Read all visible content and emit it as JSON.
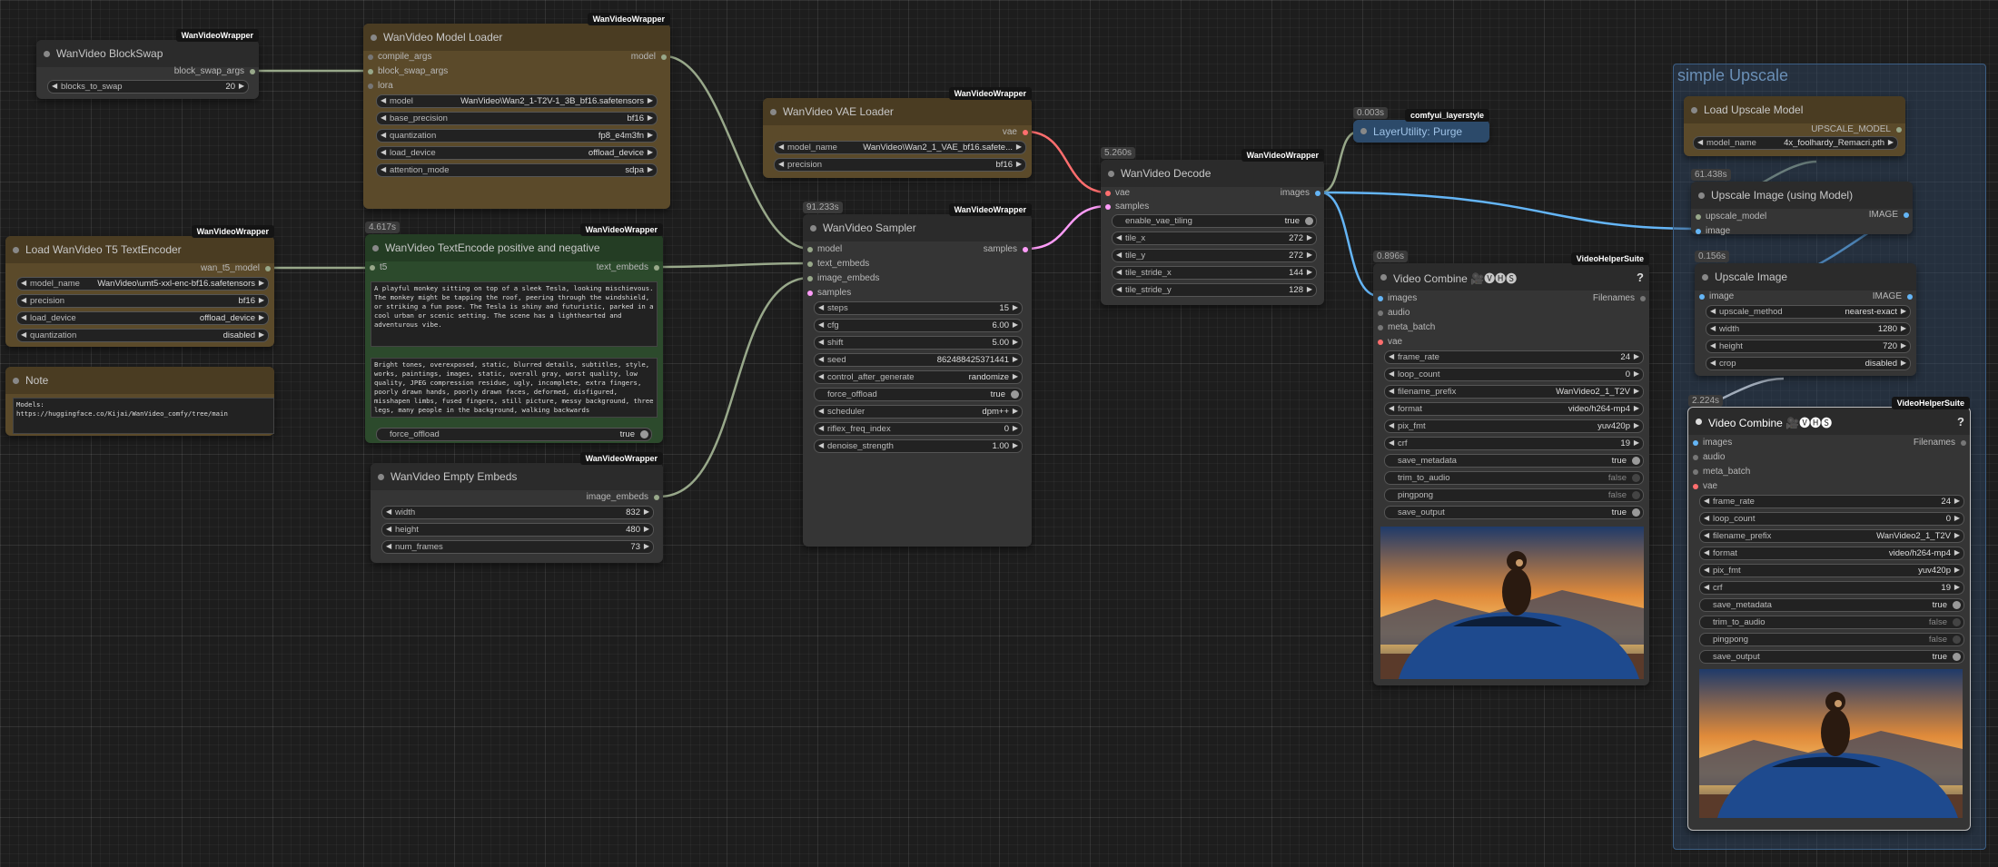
{
  "nodes": {
    "blockswap": {
      "title": "WanVideo BlockSwap",
      "badge": "WanVideoWrapper",
      "out": "block_swap_args",
      "w_blocks": {
        "label": "blocks_to_swap",
        "value": "20"
      }
    },
    "model_loader": {
      "title": "WanVideo Model Loader",
      "badge": "WanVideoWrapper",
      "in_compile": "compile_args",
      "in_block": "block_swap_args",
      "in_lora": "lora",
      "out": "model",
      "widgets": [
        {
          "label": "model",
          "value": "WanVideo\\Wan2_1-T2V-1_3B_bf16.safetensors"
        },
        {
          "label": "base_precision",
          "value": "bf16"
        },
        {
          "label": "quantization",
          "value": "fp8_e4m3fn"
        },
        {
          "label": "load_device",
          "value": "offload_device"
        },
        {
          "label": "attention_mode",
          "value": "sdpa"
        }
      ]
    },
    "t5": {
      "title": "Load WanVideo T5 TextEncoder",
      "badge": "WanVideoWrapper",
      "out": "wan_t5_model",
      "widgets": [
        {
          "label": "model_name",
          "value": "WanVideo\\umt5-xxl-enc-bf16.safetensors"
        },
        {
          "label": "precision",
          "value": "bf16"
        },
        {
          "label": "load_device",
          "value": "offload_device"
        },
        {
          "label": "quantization",
          "value": "disabled"
        }
      ]
    },
    "note": {
      "title": "Note",
      "text": "Models:\nhttps://huggingface.co/Kijai/WanVideo_comfy/tree/main"
    },
    "textencode": {
      "title": "WanVideo TextEncode positive and negative",
      "badge": "WanVideoWrapper",
      "time": "4.617s",
      "in": "t5",
      "out": "text_embeds",
      "positive": "A playful monkey sitting on top of a sleek Tesla, looking mischievous. The monkey might be tapping the roof, peering through the windshield, or striking a fun pose. The Tesla is shiny and futuristic, parked in a cool urban or scenic setting. The scene has a lighthearted and adventurous vibe.",
      "negative": "Bright tones, overexposed, static, blurred details, subtitles, style, works, paintings, images, static, overall gray, worst quality, low quality, JPEG compression residue, ugly, incomplete, extra fingers, poorly drawn hands, poorly drawn faces, deformed, disfigured, misshapen limbs, fused fingers, still picture, messy background, three legs, many people in the background, walking backwards",
      "w_offload": {
        "label": "force_offload",
        "value": "true"
      }
    },
    "empty": {
      "title": "WanVideo Empty Embeds",
      "badge": "WanVideoWrapper",
      "out": "image_embeds",
      "widgets": [
        {
          "label": "width",
          "value": "832"
        },
        {
          "label": "height",
          "value": "480"
        },
        {
          "label": "num_frames",
          "value": "73"
        }
      ]
    },
    "vae_loader": {
      "title": "WanVideo VAE Loader",
      "badge": "WanVideoWrapper",
      "out": "vae",
      "widgets": [
        {
          "label": "model_name",
          "value": "WanVideo\\Wan2_1_VAE_bf16.safete..."
        },
        {
          "label": "precision",
          "value": "bf16"
        }
      ]
    },
    "sampler": {
      "title": "WanVideo Sampler",
      "badge": "WanVideoWrapper",
      "time": "91.233s",
      "inputs": [
        "model",
        "text_embeds",
        "image_embeds",
        "samples"
      ],
      "out": "samples",
      "widgets": [
        {
          "label": "steps",
          "value": "15"
        },
        {
          "label": "cfg",
          "value": "6.00"
        },
        {
          "label": "shift",
          "value": "5.00"
        },
        {
          "label": "seed",
          "value": "862488425371441"
        },
        {
          "label": "control_after_generate",
          "value": "randomize"
        },
        {
          "label": "force_offload",
          "value": "true",
          "toggle": true
        },
        {
          "label": "scheduler",
          "value": "dpm++"
        },
        {
          "label": "riflex_freq_index",
          "value": "0"
        },
        {
          "label": "denoise_strength",
          "value": "1.00"
        }
      ]
    },
    "decode": {
      "title": "WanVideo Decode",
      "badge": "WanVideoWrapper",
      "time": "5.260s",
      "in_vae": "vae",
      "in_samples": "samples",
      "out": "images",
      "widgets": [
        {
          "label": "enable_vae_tiling",
          "value": "true",
          "toggle": true
        },
        {
          "label": "tile_x",
          "value": "272"
        },
        {
          "label": "tile_y",
          "value": "272"
        },
        {
          "label": "tile_stride_x",
          "value": "144"
        },
        {
          "label": "tile_stride_y",
          "value": "128"
        }
      ]
    },
    "purge": {
      "title": "LayerUtility: Purge",
      "badge": "comfyui_layerstyle",
      "time": "0.003s"
    },
    "vc1": {
      "title": "Video Combine 🎥🅥🅗🅢",
      "badge": "VideoHelperSuite",
      "time": "0.896s",
      "help": "?",
      "inputs": [
        "images",
        "audio",
        "meta_batch",
        "vae"
      ],
      "out": "Filenames",
      "widgets": [
        {
          "label": "frame_rate",
          "value": "24"
        },
        {
          "label": "loop_count",
          "value": "0"
        },
        {
          "label": "filename_prefix",
          "value": "WanVideo2_1_T2V"
        },
        {
          "label": "format",
          "value": "video/h264-mp4"
        },
        {
          "label": "pix_fmt",
          "value": "yuv420p"
        },
        {
          "label": "crf",
          "value": "19"
        },
        {
          "label": "save_metadata",
          "value": "true",
          "toggle": true
        },
        {
          "label": "trim_to_audio",
          "value": "false",
          "toggle": true,
          "off": true
        },
        {
          "label": "pingpong",
          "value": "false",
          "toggle": true,
          "off": true
        },
        {
          "label": "save_output",
          "value": "true",
          "toggle": true
        }
      ]
    },
    "group": {
      "title": "simple Upscale"
    },
    "upmodel": {
      "title": "Load Upscale Model",
      "out": "UPSCALE_MODEL",
      "widgets": [
        {
          "label": "model_name",
          "value": "4x_foolhardy_Remacri.pth"
        }
      ]
    },
    "upimgmodel": {
      "title": "Upscale Image (using Model)",
      "time": "61.438s",
      "inputs": [
        "upscale_model",
        "image"
      ],
      "out": "IMAGE"
    },
    "upimg": {
      "title": "Upscale Image",
      "time": "0.156s",
      "in": "image",
      "out": "IMAGE",
      "widgets": [
        {
          "label": "upscale_method",
          "value": "nearest-exact"
        },
        {
          "label": "width",
          "value": "1280"
        },
        {
          "label": "height",
          "value": "720"
        },
        {
          "label": "crop",
          "value": "disabled"
        }
      ]
    },
    "vc2": {
      "title": "Video Combine 🎥🅥🅗🅢",
      "badge": "VideoHelperSuite",
      "time": "2.224s",
      "help": "?",
      "inputs": [
        "images",
        "audio",
        "meta_batch",
        "vae"
      ],
      "out": "Filenames",
      "widgets": [
        {
          "label": "frame_rate",
          "value": "24"
        },
        {
          "label": "loop_count",
          "value": "0"
        },
        {
          "label": "filename_prefix",
          "value": "WanVideo2_1_T2V"
        },
        {
          "label": "format",
          "value": "video/h264-mp4"
        },
        {
          "label": "pix_fmt",
          "value": "yuv420p"
        },
        {
          "label": "crf",
          "value": "19"
        },
        {
          "label": "save_metadata",
          "value": "true",
          "toggle": true
        },
        {
          "label": "trim_to_audio",
          "value": "false",
          "toggle": true,
          "off": true
        },
        {
          "label": "pingpong",
          "value": "false",
          "toggle": true,
          "off": true
        },
        {
          "label": "save_output",
          "value": "true",
          "toggle": true
        }
      ]
    }
  },
  "colors": {
    "model": "#b39ddb",
    "clip": "#ffd500",
    "vae": "#ff6e6e",
    "latent": "#ff9cf9",
    "image": "#64b5f6",
    "default": "#a0b090"
  }
}
